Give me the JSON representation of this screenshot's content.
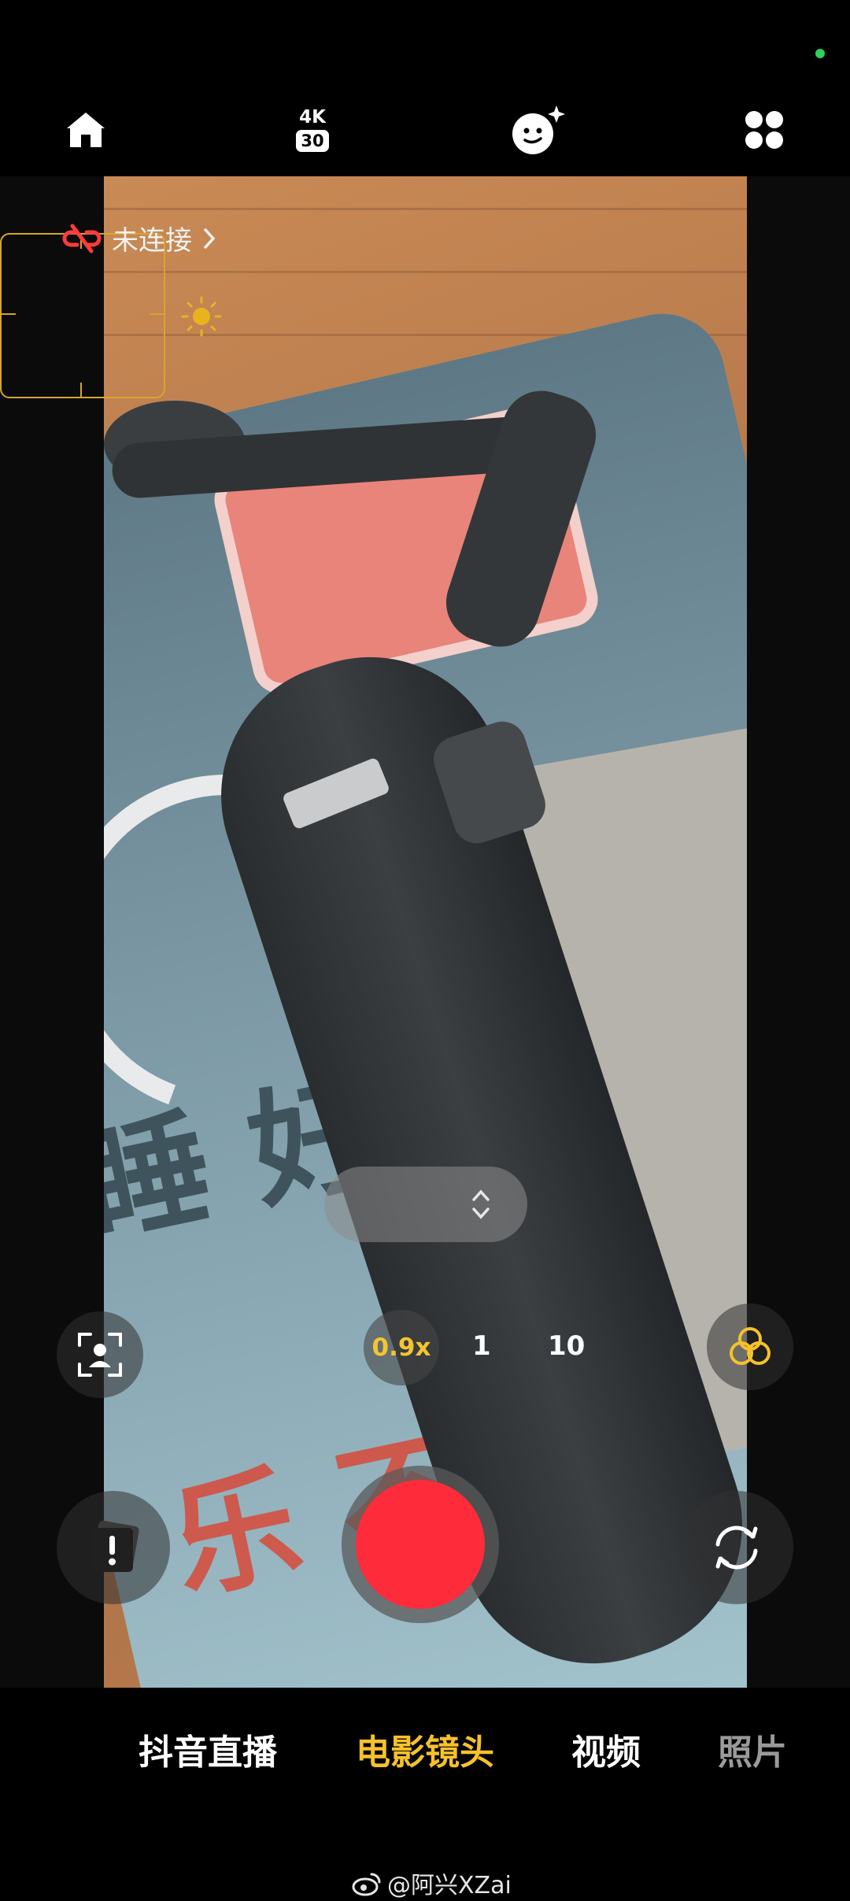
{
  "status": {
    "indicator_color": "#2bd15a"
  },
  "topbar": {
    "home_icon": "home-icon",
    "resolution": "4K",
    "framerate": "30",
    "beauty_icon": "face-sparkle-icon",
    "more_icon": "grid-icon"
  },
  "viewfinder": {
    "connection_label": "未连接",
    "connection_icon": "broken-link-icon",
    "exposure_icon": "sun-icon"
  },
  "controls": {
    "portrait_icon": "face-frame-icon",
    "filter_icon": "color-circles-icon",
    "gallery_icon": "gallery-alert-icon",
    "flip_icon": "flip-camera-icon",
    "zoom_options": [
      "0.9x",
      "1",
      "10"
    ],
    "active_zoom": "0.9x"
  },
  "modes": {
    "items": [
      "抖音直播",
      "电影镜头",
      "视频",
      "照片"
    ],
    "active": "电影镜头"
  },
  "colors": {
    "accent": "#f6c12c",
    "record": "#fe2c3a"
  },
  "watermark": "@阿兴XZai"
}
